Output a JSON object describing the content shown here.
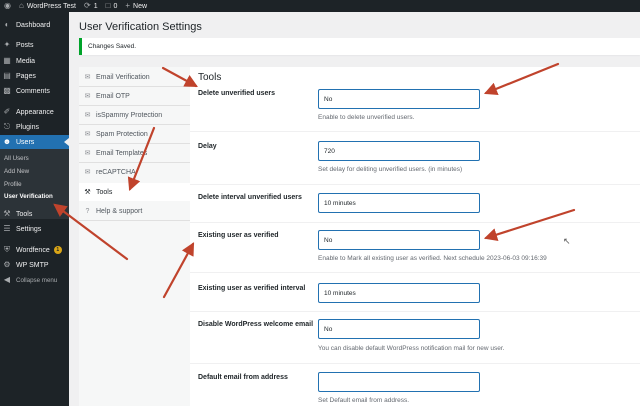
{
  "adminbar": {
    "site_name": "WordPress Test",
    "updates_count": "1",
    "comments_count": "0",
    "new_label": "New"
  },
  "sidebar": {
    "items": [
      {
        "label": "Dashboard",
        "icon": "dashboard-icon"
      },
      {
        "label": "Posts",
        "icon": "pin-icon"
      },
      {
        "label": "Media",
        "icon": "media-icon"
      },
      {
        "label": "Pages",
        "icon": "page-icon"
      },
      {
        "label": "Comments",
        "icon": "comment-icon"
      },
      {
        "label": "Appearance",
        "icon": "brush-icon"
      },
      {
        "label": "Plugins",
        "icon": "plug-icon"
      },
      {
        "label": "Users",
        "icon": "user-icon"
      },
      {
        "label": "Tools",
        "icon": "wrench-icon"
      },
      {
        "label": "Settings",
        "icon": "sliders-icon"
      },
      {
        "label": "Wordfence",
        "icon": "shield-icon",
        "badge": "1"
      },
      {
        "label": "WP SMTP",
        "icon": "gear-icon"
      },
      {
        "label": "Collapse menu",
        "icon": "collapse-icon"
      }
    ],
    "users_submenu": [
      "All Users",
      "Add New",
      "Profile",
      "User Verification"
    ]
  },
  "page": {
    "title": "User Verification Settings",
    "notice": "Changes Saved."
  },
  "tabs": [
    {
      "label": "Email Verification",
      "icon": "envelope-icon"
    },
    {
      "label": "Email OTP",
      "icon": "envelope-icon"
    },
    {
      "label": "isSpammy Protection",
      "icon": "envelope-icon"
    },
    {
      "label": "Spam Protection",
      "icon": "envelope-icon"
    },
    {
      "label": "Email Templates",
      "icon": "envelope-icon"
    },
    {
      "label": "reCAPTCHA",
      "icon": "envelope-icon"
    },
    {
      "label": "Tools",
      "icon": "tools-icon",
      "active": true
    },
    {
      "label": "Help & support",
      "icon": "help-icon"
    }
  ],
  "tools": {
    "section_title": "Tools",
    "fields": [
      {
        "label": "Delete unverified users",
        "value": "No",
        "description": "Enable to delete unverified users."
      },
      {
        "label": "Delay",
        "value": "720",
        "description": "Set delay for deliting unverified users. (in minutes)"
      },
      {
        "label": "Delete interval unverified users",
        "value": "10 minutes",
        "description": ""
      },
      {
        "label": "Existing user as verified",
        "value": "No",
        "description": "Enable to Mark all existing user as verified. Next schedule 2023-06-03 09:16:39"
      },
      {
        "label": "Existing user as verified interval",
        "value": "10 minutes",
        "description": ""
      },
      {
        "label": "Disable WordPress welcome email",
        "value": "No",
        "description": "You can disable default WordPress notification mail for new user."
      },
      {
        "label": "Default email from address",
        "value": "",
        "description": "Set Default email from address."
      }
    ]
  },
  "colors": {
    "accent": "#2271b1",
    "sidebar_bg": "#1d2327",
    "success": "#00a32a",
    "annotation_arrow": "#c0432c"
  }
}
